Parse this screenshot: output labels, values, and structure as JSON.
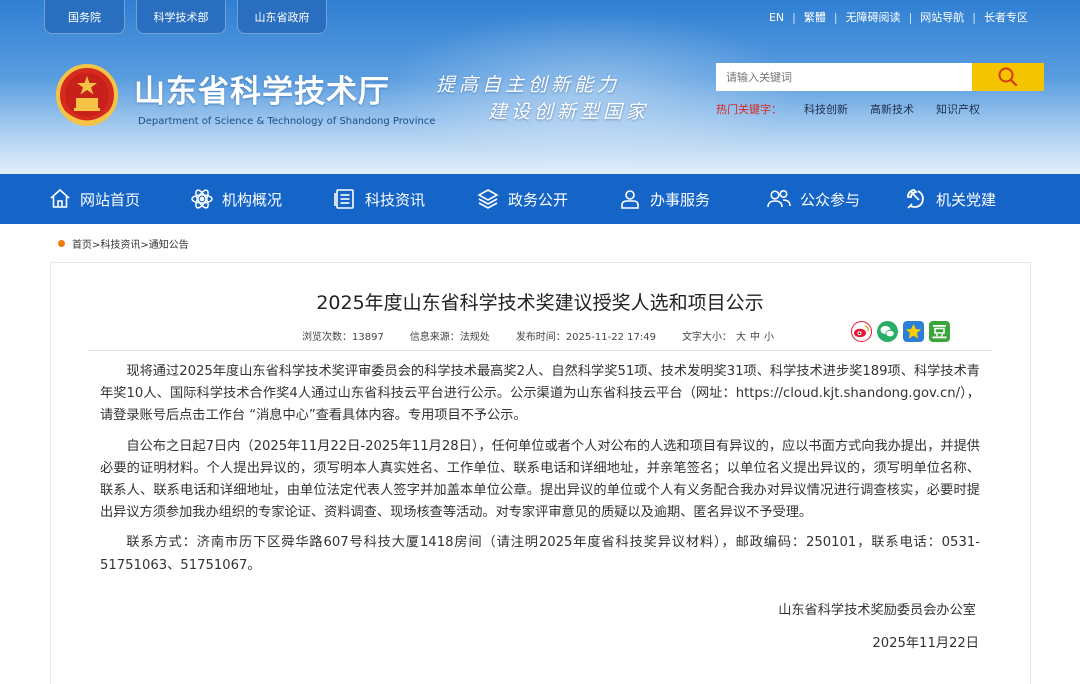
{
  "top_links": [
    "国务院",
    "科学技术部",
    "山东省政府"
  ],
  "util_links": [
    "EN",
    "繁體",
    "无障碍阅读",
    "网站导航",
    "长者专区"
  ],
  "site": {
    "title": "山东省科学技术厅",
    "subtitle": "Department of Science & Technology of Shandong Province",
    "slogan_line1": "提高自主创新能力",
    "slogan_line2": "建设创新型国家"
  },
  "search": {
    "placeholder": "请输入关键词",
    "hot_label": "热门关键字：",
    "hot_keywords": [
      "科技创新",
      "高新技术",
      "知识产权"
    ]
  },
  "nav": [
    {
      "label": "网站首页",
      "icon": "home-icon"
    },
    {
      "label": "机构概况",
      "icon": "atom-icon"
    },
    {
      "label": "科技资讯",
      "icon": "news-icon"
    },
    {
      "label": "政务公开",
      "icon": "layers-icon"
    },
    {
      "label": "办事服务",
      "icon": "service-icon"
    },
    {
      "label": "公众参与",
      "icon": "people-icon"
    },
    {
      "label": "机关党建",
      "icon": "party-icon"
    }
  ],
  "breadcrumb": [
    "首页",
    ">科技资讯",
    ">通知公告"
  ],
  "article": {
    "title": "2025年度山东省科学技术奖建议授奖人选和项目公示",
    "views_label": "浏览次数：",
    "views": "13897",
    "source_label": "信息来源：",
    "source": "法规处",
    "time_label": "发布时间：",
    "time": "2025-11-22 17:49",
    "size_label": "文字大小：",
    "sizes": [
      "大",
      "中",
      "小"
    ],
    "paragraphs": [
      "现将通过2025年度山东省科学技术奖评审委员会的科学技术最高奖2人、自然科学奖51项、技术发明奖31项、科学技术进步奖189项、科学技术青年奖10人、国际科学技术合作奖4人通过山东省科技云平台进行公示。公示渠道为山东省科技云平台（网址：https://cloud.kjt.shandong.gov.cn/），请登录账号后点击工作台 “消息中心”查看具体内容。专用项目不予公示。",
      "自公布之日起7日内（2025年11月22日-2025年11月28日），任何单位或者个人对公布的人选和项目有异议的，应以书面方式向我办提出，并提供必要的证明材料。个人提出异议的，须写明本人真实姓名、工作单位、联系电话和详细地址，并亲笔签名；以单位名义提出异议的，须写明单位名称、联系人、联系电话和详细地址，由单位法定代表人签字并加盖本单位公章。提出异议的单位或个人有义务配合我办对异议情况进行调查核实，必要时提出异议方须参加我办组织的专家论证、资料调查、现场核查等活动。对专家评审意见的质疑以及逾期、匿名异议不予受理。",
      "联系方式：济南市历下区舜华路607号科技大厦1418房间（请注明2025年度省科技奖异议材料），邮政编码：250101，联系电话：0531-51751063、51751067。"
    ],
    "signature": "山东省科学技术奖励委员会办公室",
    "date": "2025年11月22日"
  },
  "colors": {
    "nav_bg": "#1565c8",
    "search_btn": "#f5c400",
    "hot_label": "#d8281e",
    "breadcrumb_dot": "#f0790a"
  }
}
